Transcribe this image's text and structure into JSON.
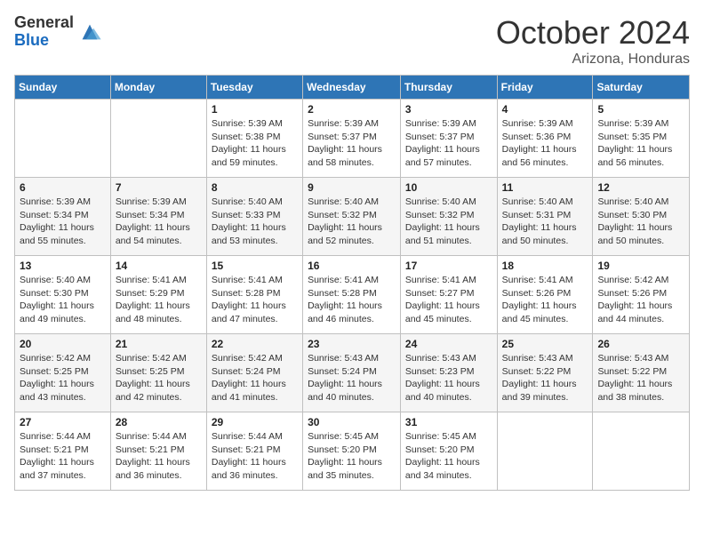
{
  "logo": {
    "general": "General",
    "blue": "Blue"
  },
  "title": "October 2024",
  "subtitle": "Arizona, Honduras",
  "days_header": [
    "Sunday",
    "Monday",
    "Tuesday",
    "Wednesday",
    "Thursday",
    "Friday",
    "Saturday"
  ],
  "weeks": [
    [
      {
        "day": "",
        "info": ""
      },
      {
        "day": "",
        "info": ""
      },
      {
        "day": "1",
        "info": "Sunrise: 5:39 AM\nSunset: 5:38 PM\nDaylight: 11 hours and 59 minutes."
      },
      {
        "day": "2",
        "info": "Sunrise: 5:39 AM\nSunset: 5:37 PM\nDaylight: 11 hours and 58 minutes."
      },
      {
        "day": "3",
        "info": "Sunrise: 5:39 AM\nSunset: 5:37 PM\nDaylight: 11 hours and 57 minutes."
      },
      {
        "day": "4",
        "info": "Sunrise: 5:39 AM\nSunset: 5:36 PM\nDaylight: 11 hours and 56 minutes."
      },
      {
        "day": "5",
        "info": "Sunrise: 5:39 AM\nSunset: 5:35 PM\nDaylight: 11 hours and 56 minutes."
      }
    ],
    [
      {
        "day": "6",
        "info": "Sunrise: 5:39 AM\nSunset: 5:34 PM\nDaylight: 11 hours and 55 minutes."
      },
      {
        "day": "7",
        "info": "Sunrise: 5:39 AM\nSunset: 5:34 PM\nDaylight: 11 hours and 54 minutes."
      },
      {
        "day": "8",
        "info": "Sunrise: 5:40 AM\nSunset: 5:33 PM\nDaylight: 11 hours and 53 minutes."
      },
      {
        "day": "9",
        "info": "Sunrise: 5:40 AM\nSunset: 5:32 PM\nDaylight: 11 hours and 52 minutes."
      },
      {
        "day": "10",
        "info": "Sunrise: 5:40 AM\nSunset: 5:32 PM\nDaylight: 11 hours and 51 minutes."
      },
      {
        "day": "11",
        "info": "Sunrise: 5:40 AM\nSunset: 5:31 PM\nDaylight: 11 hours and 50 minutes."
      },
      {
        "day": "12",
        "info": "Sunrise: 5:40 AM\nSunset: 5:30 PM\nDaylight: 11 hours and 50 minutes."
      }
    ],
    [
      {
        "day": "13",
        "info": "Sunrise: 5:40 AM\nSunset: 5:30 PM\nDaylight: 11 hours and 49 minutes."
      },
      {
        "day": "14",
        "info": "Sunrise: 5:41 AM\nSunset: 5:29 PM\nDaylight: 11 hours and 48 minutes."
      },
      {
        "day": "15",
        "info": "Sunrise: 5:41 AM\nSunset: 5:28 PM\nDaylight: 11 hours and 47 minutes."
      },
      {
        "day": "16",
        "info": "Sunrise: 5:41 AM\nSunset: 5:28 PM\nDaylight: 11 hours and 46 minutes."
      },
      {
        "day": "17",
        "info": "Sunrise: 5:41 AM\nSunset: 5:27 PM\nDaylight: 11 hours and 45 minutes."
      },
      {
        "day": "18",
        "info": "Sunrise: 5:41 AM\nSunset: 5:26 PM\nDaylight: 11 hours and 45 minutes."
      },
      {
        "day": "19",
        "info": "Sunrise: 5:42 AM\nSunset: 5:26 PM\nDaylight: 11 hours and 44 minutes."
      }
    ],
    [
      {
        "day": "20",
        "info": "Sunrise: 5:42 AM\nSunset: 5:25 PM\nDaylight: 11 hours and 43 minutes."
      },
      {
        "day": "21",
        "info": "Sunrise: 5:42 AM\nSunset: 5:25 PM\nDaylight: 11 hours and 42 minutes."
      },
      {
        "day": "22",
        "info": "Sunrise: 5:42 AM\nSunset: 5:24 PM\nDaylight: 11 hours and 41 minutes."
      },
      {
        "day": "23",
        "info": "Sunrise: 5:43 AM\nSunset: 5:24 PM\nDaylight: 11 hours and 40 minutes."
      },
      {
        "day": "24",
        "info": "Sunrise: 5:43 AM\nSunset: 5:23 PM\nDaylight: 11 hours and 40 minutes."
      },
      {
        "day": "25",
        "info": "Sunrise: 5:43 AM\nSunset: 5:22 PM\nDaylight: 11 hours and 39 minutes."
      },
      {
        "day": "26",
        "info": "Sunrise: 5:43 AM\nSunset: 5:22 PM\nDaylight: 11 hours and 38 minutes."
      }
    ],
    [
      {
        "day": "27",
        "info": "Sunrise: 5:44 AM\nSunset: 5:21 PM\nDaylight: 11 hours and 37 minutes."
      },
      {
        "day": "28",
        "info": "Sunrise: 5:44 AM\nSunset: 5:21 PM\nDaylight: 11 hours and 36 minutes."
      },
      {
        "day": "29",
        "info": "Sunrise: 5:44 AM\nSunset: 5:21 PM\nDaylight: 11 hours and 36 minutes."
      },
      {
        "day": "30",
        "info": "Sunrise: 5:45 AM\nSunset: 5:20 PM\nDaylight: 11 hours and 35 minutes."
      },
      {
        "day": "31",
        "info": "Sunrise: 5:45 AM\nSunset: 5:20 PM\nDaylight: 11 hours and 34 minutes."
      },
      {
        "day": "",
        "info": ""
      },
      {
        "day": "",
        "info": ""
      }
    ]
  ]
}
